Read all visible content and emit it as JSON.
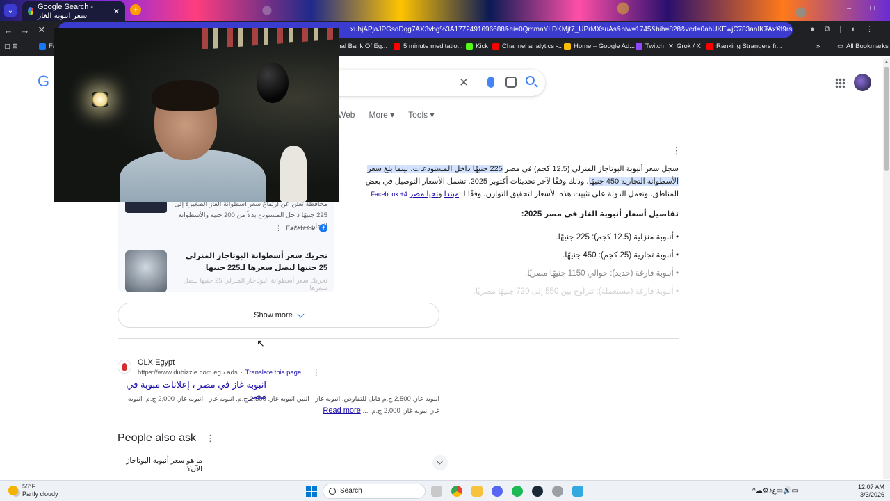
{
  "browser": {
    "tab_title": "Google Search - سعر انبوبه الغاز",
    "url": "xuhjAPjaJPGsdDqg7AX3vbg%3A1772491696688&ei=0QmmaYLDKMjt7_UPrMXsuAs&biw=1745&bih=828&ved=0ahUKEwjC783anIKTAxXI9rsIHaw...",
    "bookmarks": [
      {
        "label": "ational Bank Of Eg...",
        "color": "#7a1f1f"
      },
      {
        "label": "5 minute meditatio...",
        "color": "#ff0000"
      },
      {
        "label": "Kick",
        "color": "#53fc18"
      },
      {
        "label": "Channel analytics -...",
        "color": "#ff0000"
      },
      {
        "label": "Home – Google Ad...",
        "color": "#fbbc05"
      },
      {
        "label": "Twitch",
        "color": "#9146ff"
      },
      {
        "label": "Grok / X",
        "color": "#ffffff"
      },
      {
        "label": "Ranking Strangers fr...",
        "color": "#ff0000"
      },
      {
        "label": "All Bookmarks",
        "color": "#e8eaed"
      }
    ]
  },
  "search": {
    "tabs": [
      "Web",
      "More",
      "Tools"
    ]
  },
  "overview": {
    "p1_a": "سجل سعر أنبوبة البوتاجاز المنزلي (12.5 كجم) في مصر",
    "p1_hl": "225 جنيهًا داخل المستودعات، بينما بلغ سعر الأسطوانة التجارية 450 جنيهًا",
    "p1_b": "، وذلك وفقًا لآخر تحديثات أكتوبر 2025. تشمل الأسعار التوصيل في بعض المناطق، وتعمل الدولة على تثبيت هذه الأسعار لتحقيق التوازن، وفقًا لـ",
    "link1": "مبتدا",
    "and": " و",
    "link2": "تحيا مصر",
    "fb_chip": "Facebook +4",
    "heading": "تفاصيل أسعار أنبوبة الغاز في مصر 2025:",
    "items": [
      "أنبوبة منزلية (12.5 كجم): 225 جنيهًا.",
      "أنبوبة تجارية (25 كجم): 450 جنيهًا.",
      "أنبوبة فارغة (حديد): حوالي 1150 جنيهًا مصريًا.",
      "أنبوبة فارغة (مستعملة): تتراوح بين 550 إلى 720 جنيهًا مصريًا."
    ]
  },
  "sources": {
    "s1_text": "محافظة تعلن عن ارتفاع سعر أسطوانة الغاز الصغيرة إلى 225 جنيهًا داخل المستودع بدلاً من 200 جنيه والأسطوانة التجارية بسعر...",
    "s1_site": "Facebook",
    "s2_title": "تحريك سعر أسطوانة البوتاجاز المنزلي 25 جنيها ليصل سعرها لـ225 جنيها",
    "s2_fade": "تحريك سعر أسطوانة البوتاجاز المنزلي 25 جنيها ليصل سعرها"
  },
  "show_more": "Show more",
  "ad": {
    "name": "OLX Egypt",
    "url": "https://www.dubizzle.com.eg › ads",
    "translate": "Translate this page",
    "title": "انبوبه غاز في مصر ، إعلانات مبوبة في مصر",
    "desc": "انبوبه غاز. 2,500 ج.م قابل للتفاوض. انبوبه غاز · اتنين انبوبه غاز. 2,300 ج.م. انبوبه غاز · انبوبه غاز. 2,000 ج.م. انبوبه غاز انبوبه غاز. 2,000 ج.م. ...",
    "read_more": "Read more"
  },
  "paa": {
    "title": "People also ask",
    "q1": "ما هو سعر أنبوبة البوتاجاز الآن؟"
  },
  "taskbar": {
    "temp": "55°F",
    "condition": "Partly cloudy",
    "search": "Search",
    "time": "12:07 AM",
    "date": "3/3/2026",
    "app_colors": [
      "#c9c9c9",
      "#ea4335",
      "#f8c33c",
      "#5865f2",
      "#1db954",
      "#1b2838",
      "#9aa0a6",
      "#34a8e0"
    ]
  }
}
